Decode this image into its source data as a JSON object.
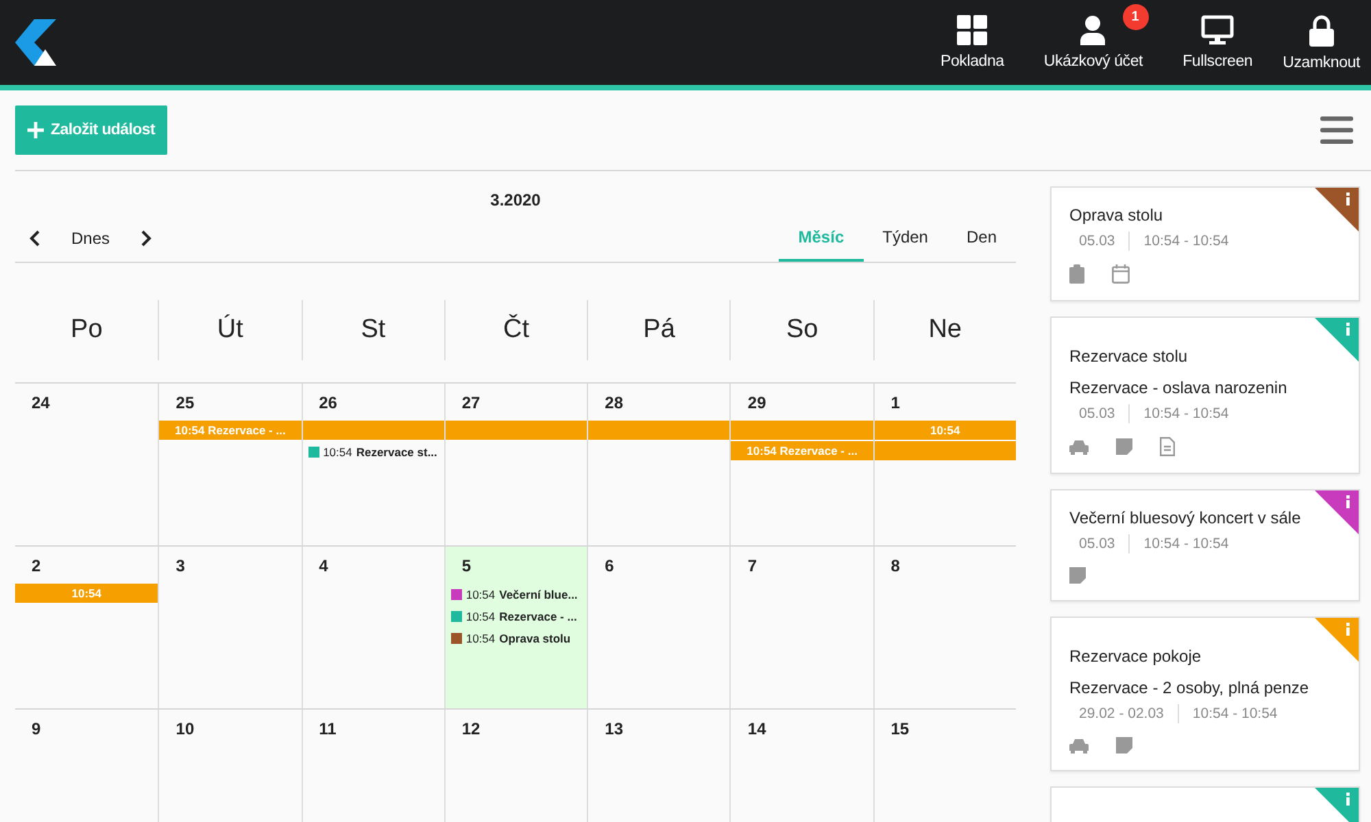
{
  "header": {
    "nav": [
      {
        "kind": "grid",
        "label": "Pokladna"
      },
      {
        "kind": "user",
        "label": "Ukázkový účet",
        "badge": "1"
      },
      {
        "kind": "monitor",
        "label": "Fullscreen"
      },
      {
        "kind": "lock",
        "label": "Uzamknout"
      }
    ]
  },
  "toolbar": {
    "create_button": "Založit událost"
  },
  "calendar": {
    "title": "3.2020",
    "today_button": "Dnes",
    "views": [
      {
        "label": "Měsíc",
        "selected": true
      },
      {
        "label": "Týden",
        "selected": false
      },
      {
        "label": "Den",
        "selected": false
      }
    ],
    "weekdays": [
      "Po",
      "Út",
      "St",
      "Čt",
      "Pá",
      "So",
      "Ne"
    ],
    "weeks": [
      {
        "days": [
          {
            "number": "24",
            "today": false
          },
          {
            "number": "25",
            "today": false,
            "items": [
              {
                "kind": "bar",
                "text": "10:54 Rezervace - ..."
              }
            ]
          },
          {
            "number": "26",
            "today": false,
            "items": [
              {
                "kind": "bar"
              },
              {
                "kind": "dot",
                "color": "#1fb99d",
                "time": "10:54",
                "title": "Rezervace st..."
              }
            ]
          },
          {
            "number": "27",
            "today": false,
            "items": [
              {
                "kind": "bar"
              }
            ]
          },
          {
            "number": "28",
            "today": false,
            "items": [
              {
                "kind": "bar"
              }
            ]
          },
          {
            "number": "29",
            "today": false,
            "items": [
              {
                "kind": "bar"
              },
              {
                "kind": "bar",
                "text": "10:54 Rezervace - ..."
              }
            ]
          },
          {
            "number": "1",
            "today": false,
            "items": [
              {
                "kind": "bar",
                "text": "10:54"
              },
              {
                "kind": "bar"
              }
            ]
          }
        ]
      },
      {
        "days": [
          {
            "number": "2",
            "today": false,
            "items": [
              {
                "kind": "bar",
                "text": "10:54"
              }
            ]
          },
          {
            "number": "3",
            "today": false
          },
          {
            "number": "4",
            "today": false
          },
          {
            "number": "5",
            "today": true,
            "items": [
              {
                "kind": "dot",
                "color": "#c83bbd",
                "time": "10:54",
                "title": "Večerní blue..."
              },
              {
                "kind": "dot",
                "color": "#1fb99d",
                "time": "10:54",
                "title": "Rezervace - ..."
              },
              {
                "kind": "dot",
                "color": "#9b5528",
                "time": "10:54",
                "title": "Oprava stolu"
              }
            ]
          },
          {
            "number": "6",
            "today": false
          },
          {
            "number": "7",
            "today": false
          },
          {
            "number": "8",
            "today": false
          }
        ]
      },
      {
        "days": [
          {
            "number": "9",
            "today": false
          },
          {
            "number": "10",
            "today": false
          },
          {
            "number": "11",
            "today": false
          },
          {
            "number": "12",
            "today": false
          },
          {
            "number": "13",
            "today": false
          },
          {
            "number": "14",
            "today": false
          },
          {
            "number": "15",
            "today": false
          }
        ]
      }
    ]
  },
  "events": [
    {
      "color": "#9b5528",
      "title": "Oprava stolu",
      "date": "05.03",
      "time": "10:54 - 10:54",
      "icons": [
        {
          "kind": "clipboard"
        },
        {
          "kind": "calendar"
        }
      ]
    },
    {
      "color": "#1fb99d",
      "title": "Rezervace stolu",
      "subtitle": "Rezervace - oslava narozenin",
      "date": "05.03",
      "time": "10:54 - 10:54",
      "icons": [
        {
          "kind": "car"
        },
        {
          "kind": "note"
        },
        {
          "kind": "document"
        }
      ]
    },
    {
      "color": "#c83bbd",
      "title": "Večerní bluesový koncert v sále",
      "date": "05.03",
      "time": "10:54 - 10:54",
      "icons": [
        {
          "kind": "note"
        }
      ]
    },
    {
      "color": "#f5a000",
      "title": "Rezervace pokoje",
      "subtitle": "Rezervace - 2 osoby, plná penze",
      "date": "29.02 - 02.03",
      "time": "10:54 - 10:54",
      "icons": [
        {
          "kind": "car"
        },
        {
          "kind": "note"
        }
      ]
    },
    {
      "color": "#1fb99d"
    }
  ]
}
